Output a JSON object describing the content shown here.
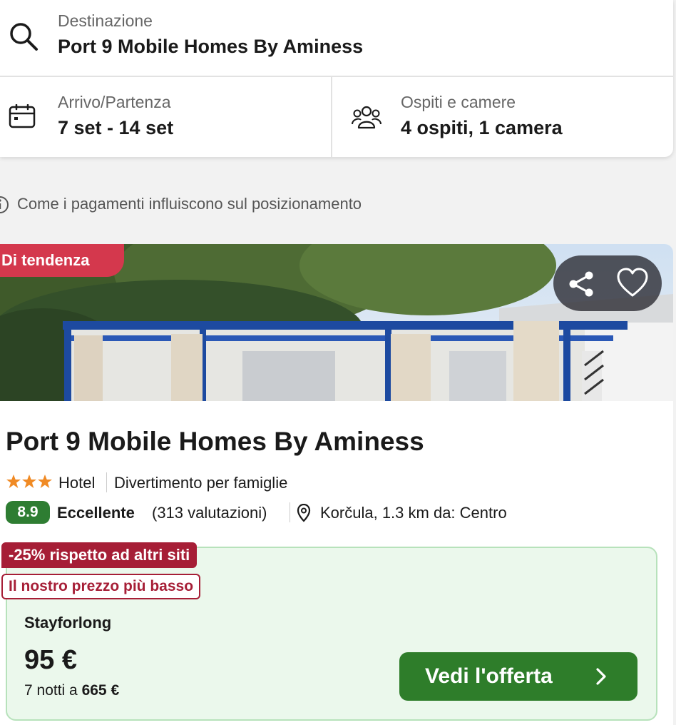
{
  "search": {
    "destination_label": "Destinazione",
    "destination_value": "Port 9 Mobile Homes By Aminess",
    "dates_label": "Arrivo/Partenza",
    "dates_value": "7 set - 14 set",
    "guests_label": "Ospiti e camere",
    "guests_value": "4 ospiti, 1 camera"
  },
  "info": {
    "text": "Come i pagamenti influiscono sul posizionamento"
  },
  "hotel": {
    "trend_badge": "Di tendenza",
    "name": "Port 9 Mobile Homes By Aminess",
    "stars": 3,
    "type": "Hotel",
    "category": "Divertimento per famiglie",
    "score": "8.9",
    "score_label": "Eccellente",
    "score_count": "(313 valutazioni)",
    "location": "Korčula, 1.3 km da: Centro"
  },
  "offer": {
    "discount": "-25% rispetto ad altri siti",
    "lowest": "Il nostro prezzo più basso",
    "provider": "Stayforlong",
    "price": "95 €",
    "nights_prefix": "7 notti a",
    "total": "665 €",
    "cta_label": "Vedi l'offerta"
  },
  "colors": {
    "trend_badge": "#d4384d",
    "discount_badge": "#a61e36",
    "score_bg": "#2e7d32",
    "cta_bg": "#2e7d2a",
    "offer_bg": "#ebf8ec"
  },
  "icons": {
    "search": "search-icon",
    "calendar": "calendar-icon",
    "guests": "people-icon",
    "info": "info-icon",
    "share": "share-icon",
    "favorite": "heart-icon",
    "location": "map-pin-icon",
    "cta": "chevron-right-icon"
  }
}
